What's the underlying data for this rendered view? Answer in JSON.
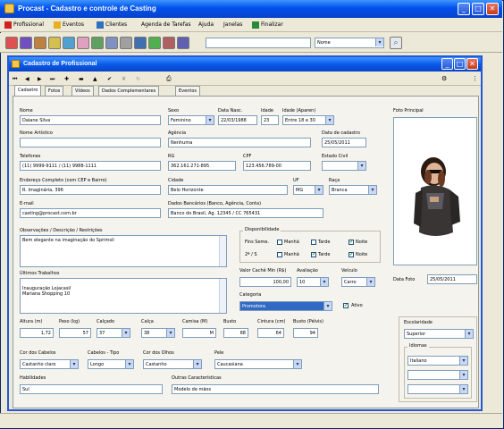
{
  "app": {
    "title": "Procast - Cadastro e controle de Casting",
    "menu": [
      "Profissional",
      "Eventos",
      "Clientes",
      "Agenda de Tarefas",
      "Ajuda",
      "Janelas",
      "Finalizar"
    ],
    "search": {
      "placeholder": "",
      "field_value": "Nome"
    }
  },
  "child": {
    "title": "Cadastro de Profissional",
    "tabs": [
      "Cadastro",
      "Fotos",
      "Vídeos",
      "Dados Complementares",
      "Eventos"
    ],
    "active_tab": "Cadastro"
  },
  "form": {
    "nome": {
      "label": "Nome",
      "value": "Daiane Silva"
    },
    "nome_artistico": {
      "label": "Nome Artístico",
      "value": ""
    },
    "sexo": {
      "label": "Sexo",
      "value": "Feminino"
    },
    "data_nasc": {
      "label": "Data Nasc.",
      "value": "22/03/1988"
    },
    "idade": {
      "label": "Idade",
      "value": "23"
    },
    "idade_aparente": {
      "label": "Idade (Aparen)",
      "value": "Entre 18 e 30"
    },
    "agencia": {
      "label": "Agência",
      "value": "Nenhuma"
    },
    "data_cadastro": {
      "label": "Data de cadastro",
      "value": "25/05/2011"
    },
    "telefones": {
      "label": "Telefones",
      "value": "(11) 9999-9111 / (11) 9988-1111"
    },
    "rg": {
      "label": "RG",
      "value": "362.161.271-895"
    },
    "cpf": {
      "label": "CPF",
      "value": "123.456.789-00"
    },
    "estado_civil": {
      "label": "Estado Civil",
      "value": ""
    },
    "endereco": {
      "label": "Endereço Completo (com CEP e Bairro)",
      "value": "R. Imaginária, 396"
    },
    "cidade": {
      "label": "Cidade",
      "value": "Belo Horizonte"
    },
    "uf": {
      "label": "UF",
      "value": "MG"
    },
    "raca": {
      "label": "Raça",
      "value": "Branca"
    },
    "email": {
      "label": "E-mail",
      "value": "casting@procast.com.br"
    },
    "dados_bancarios": {
      "label": "Dados Bancários (Banco, Agência, Conta)",
      "value": "Banco do Brasil, Ag. 12345 / CC 765431"
    },
    "observacoes": {
      "label": "Observações / Descrição / Restrições",
      "value": "Bem elegante na imaginação do Sprimsil"
    },
    "ultimos_trabalhos": {
      "label": "Últimos Trabalhos",
      "value": "Inauguração Lojacasil\nMariana Shopping 10"
    },
    "disponibilidade": {
      "label": "Disponibilidade",
      "row1_label": "Fins Seme.",
      "row2_label": "2ª / S",
      "options": [
        "Manhã",
        "Tarde",
        "Noite"
      ]
    },
    "valor_cache": {
      "label": "Valor Cachê Min (R$)",
      "value": "100,00"
    },
    "avaliacao": {
      "label": "Avaliação",
      "value": "10"
    },
    "veiculo": {
      "label": "Veículo",
      "value": "Carro"
    },
    "categoria": {
      "label": "Categoria",
      "value": "Promotora"
    },
    "ativo": {
      "label": "Ativo"
    },
    "data_foto": {
      "label": "Data Foto",
      "value": "25/05/2011"
    },
    "foto_principal": {
      "label": "Foto Principal"
    },
    "altura": {
      "label": "Altura (m)",
      "value": "1,72"
    },
    "peso": {
      "label": "Peso (kg)",
      "value": "57"
    },
    "calcado": {
      "label": "Calçado",
      "value": "37"
    },
    "calca": {
      "label": "Calça",
      "value": "38"
    },
    "camisa": {
      "label": "Camisa (M)",
      "value": "M"
    },
    "busto": {
      "label": "Busto",
      "value": "88"
    },
    "cintura": {
      "label": "Cintura (cm)",
      "value": "64"
    },
    "quadril": {
      "label": "Busto (Pélvis)",
      "value": "94"
    },
    "cor_cabelos": {
      "label": "Cor dos Cabelos",
      "value": "Castanho claro"
    },
    "cabelos_tipo": {
      "label": "Cabelos - Tipo",
      "value": "Longo"
    },
    "cor_olhos": {
      "label": "Cor dos Olhos",
      "value": "Castanho"
    },
    "pele": {
      "label": "Pele",
      "value": "Caucasiana"
    },
    "outras_carac": {
      "label": "Outras Características",
      "value": "Modelo de mãos"
    },
    "habilidades": {
      "label": "Habilidades",
      "value": "Sul"
    },
    "escolaridade": {
      "label": "Escolaridade",
      "value": "Superior"
    },
    "idiomas": {
      "label": "Idiomas",
      "values": [
        "Italiano",
        "",
        ""
      ]
    }
  }
}
